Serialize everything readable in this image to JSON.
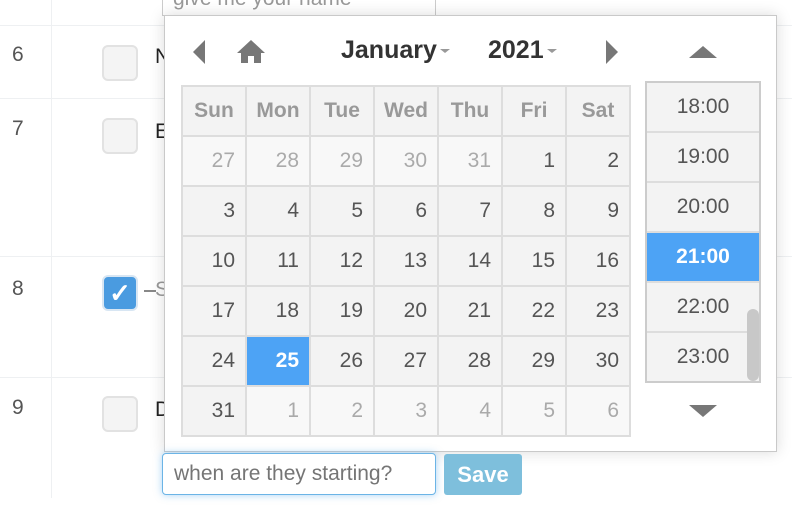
{
  "table": {
    "rows": [
      {
        "num": "6",
        "checked": false,
        "text_fragment": "N"
      },
      {
        "num": "7",
        "checked": false,
        "text_fragment": "E"
      },
      {
        "num": "8",
        "checked": true,
        "text_fragment": "S"
      },
      {
        "num": "9",
        "checked": false,
        "text_fragment": "D"
      }
    ],
    "checkmark_glyph": "✓"
  },
  "name_input": {
    "placeholder": "give me your name"
  },
  "datepicker": {
    "month": "January",
    "year": "2021",
    "weekdays": [
      "Sun",
      "Mon",
      "Tue",
      "Wed",
      "Thu",
      "Fri",
      "Sat"
    ],
    "weeks": [
      [
        {
          "d": "27",
          "other": true
        },
        {
          "d": "28",
          "other": true
        },
        {
          "d": "29",
          "other": true
        },
        {
          "d": "30",
          "other": true
        },
        {
          "d": "31",
          "other": true
        },
        {
          "d": "1"
        },
        {
          "d": "2"
        }
      ],
      [
        {
          "d": "3"
        },
        {
          "d": "4"
        },
        {
          "d": "5"
        },
        {
          "d": "6"
        },
        {
          "d": "7"
        },
        {
          "d": "8"
        },
        {
          "d": "9"
        }
      ],
      [
        {
          "d": "10"
        },
        {
          "d": "11"
        },
        {
          "d": "12"
        },
        {
          "d": "13"
        },
        {
          "d": "14"
        },
        {
          "d": "15"
        },
        {
          "d": "16"
        }
      ],
      [
        {
          "d": "17"
        },
        {
          "d": "18"
        },
        {
          "d": "19"
        },
        {
          "d": "20"
        },
        {
          "d": "21"
        },
        {
          "d": "22"
        },
        {
          "d": "23"
        }
      ],
      [
        {
          "d": "24"
        },
        {
          "d": "25",
          "selected": true
        },
        {
          "d": "26"
        },
        {
          "d": "27"
        },
        {
          "d": "28"
        },
        {
          "d": "29"
        },
        {
          "d": "30"
        }
      ],
      [
        {
          "d": "31"
        },
        {
          "d": "1",
          "other": true
        },
        {
          "d": "2",
          "other": true
        },
        {
          "d": "3",
          "other": true
        },
        {
          "d": "4",
          "other": true
        },
        {
          "d": "5",
          "other": true
        },
        {
          "d": "6",
          "other": true
        }
      ]
    ],
    "selected_day": "25",
    "times": [
      "18:00",
      "19:00",
      "20:00",
      "21:00",
      "22:00",
      "23:00"
    ],
    "selected_time": "21:00",
    "accent_color": "#4da3f5"
  },
  "edit": {
    "when_placeholder": "when are they starting?",
    "save_label": "Save"
  }
}
